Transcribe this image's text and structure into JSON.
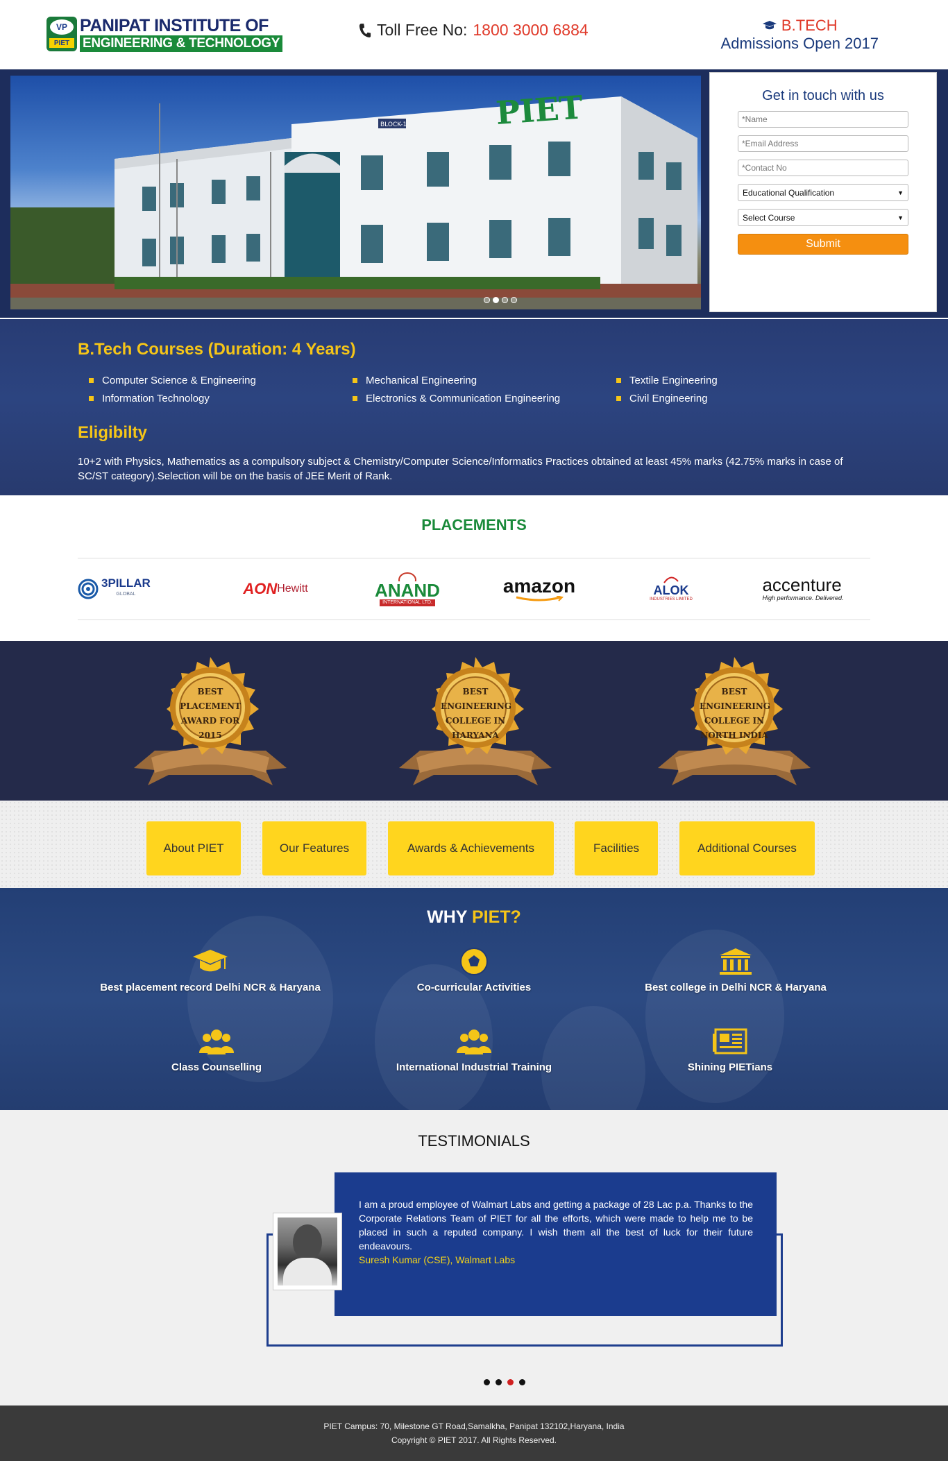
{
  "header": {
    "logo_line1": "PANIPAT INSTITUTE OF",
    "logo_line2": "ENGINEERING & TECHNOLOGY",
    "logo_emblem_top": "VP",
    "logo_emblem_bottom": "PIET",
    "tollfree_label": "Toll Free No:",
    "tollfree_number": "1800 3000 6884",
    "admissions_top": "B.TECH",
    "admissions_bottom": "Admissions Open 2017"
  },
  "hero": {
    "building_sign": "PIET",
    "block_sign": "BLOCK-1",
    "slider_active_index": 1
  },
  "form": {
    "title": "Get in touch with us",
    "name_placeholder": "*Name",
    "email_placeholder": "*Email Address",
    "contact_placeholder": "*Contact No",
    "qualification_value": "Educational Qualification",
    "course_value": "Select Course",
    "submit_label": "Submit"
  },
  "courses": {
    "title": "B.Tech Courses (Duration: 4 Years)",
    "items": [
      "Computer Science & Engineering",
      "Mechanical Engineering",
      "Textile Engineering",
      "Information Technology",
      "Electronics & Communication Engineering",
      "Civil Engineering"
    ],
    "eligibility_title": "Eligibilty",
    "eligibility_text": "10+2 with Physics, Mathematics as a compulsory subject & Chemistry/Computer Science/Informatics Practices obtained at least 45% marks (42.75% marks in case of SC/ST category).Selection will be on the basis of JEE Merit of Rank."
  },
  "placements": {
    "title": "PLACEMENTS",
    "companies": {
      "pillar": "3PILLAR",
      "pillar_sub": "GLOBAL",
      "aon": "AON",
      "aon_sub": "Hewitt",
      "anand": "ANAND",
      "anand_sub": "INTERNATIONAL LTD.",
      "amazon": "amazon",
      "alok": "ALOK",
      "alok_sub": "INDUSTRIES LIMITED",
      "accenture": "accenture",
      "accenture_sub": "High performance. Delivered."
    }
  },
  "awards": [
    "BEST PLACEMENT AWARD FOR 2015",
    "BEST ENGINEERING COLLEGE IN HARYANA",
    "BEST ENGINEERING COLLEGE IN NORTH INDIA"
  ],
  "tabs": [
    "About PIET",
    "Our Features",
    "Awards & Achievements",
    "Facilities",
    "Additional Courses"
  ],
  "why": {
    "title_a": "WHY ",
    "title_b": "PIET?",
    "items": [
      "Best placement record Delhi NCR & Haryana",
      "Co-curricular Activities",
      "Best college in Delhi NCR & Haryana",
      "Class Counselling",
      "International Industrial Training",
      "Shining PIETians"
    ]
  },
  "testimonials": {
    "title": "TESTIMONIALS",
    "text": "I am a proud employee of Walmart Labs and getting a package of 28 Lac p.a. Thanks to the Corporate Relations Team of PIET for all the efforts, which were made to help me to be placed in such a reputed company. I wish them all the best of luck for their future endeavours.",
    "author": "Suresh Kumar (CSE), Walmart Labs",
    "active_dot": 2
  },
  "footer": {
    "address": "PIET Campus: 70, Milestone GT Road,Samalkha, Panipat 132102,Haryana, India",
    "copyright": "Copyright © PIET 2017. All Rights Reserved."
  },
  "colors": {
    "navy": "#1d2d5c",
    "gold": "#f5c518",
    "orange": "#f58f10",
    "green": "#1a8a3a",
    "red": "#e03a2a",
    "tab_yellow": "#ffd51e"
  },
  "icons": {
    "phone": "phone-icon",
    "graduation": "graduation-cap-icon",
    "ball": "football-icon",
    "bank": "institution-icon",
    "group": "group-icon",
    "news": "newspaper-icon"
  }
}
